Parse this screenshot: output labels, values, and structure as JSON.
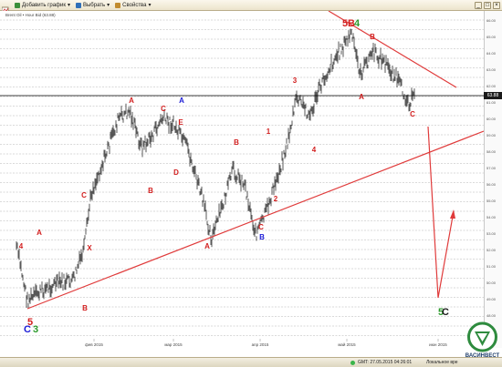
{
  "toolbar": {
    "add_chart": "Добавить график",
    "select": "Выбрать",
    "properties": "Свойства"
  },
  "chart": {
    "legend": "Brent Oil  •  Hour Bid (63.88)",
    "current_price": "63.88",
    "months": [
      "фев 2015",
      "мар 2015",
      "апр 2015",
      "май 2015",
      "июн 2015"
    ],
    "y_ticks": [
      "66.00",
      "65.00",
      "64.00",
      "63.00",
      "62.00",
      "61.00",
      "60.00",
      "59.00",
      "58.00",
      "57.00",
      "56.00",
      "55.00",
      "54.00",
      "53.00",
      "52.00",
      "51.00",
      "50.00",
      "49.00",
      "48.00",
      "47.00"
    ],
    "wave_labels": [
      {
        "t": "A",
        "c": "#d21f1f"
      },
      {
        "t": "A",
        "c": "#1b1bd6"
      },
      {
        "t": "C",
        "c": "#d21f1f"
      },
      {
        "t": "E",
        "c": "#d21f1f"
      },
      {
        "t": "3",
        "c": "#d21f1f"
      },
      {
        "t": "1",
        "c": "#d21f1f"
      },
      {
        "t": "B",
        "c": "#d21f1f"
      },
      {
        "t": "C",
        "c": "#d21f1f"
      },
      {
        "t": "D",
        "c": "#d21f1f"
      },
      {
        "t": "B",
        "c": "#d21f1f"
      },
      {
        "t": "B",
        "c": "#d21f1f"
      },
      {
        "t": "X",
        "c": "#d21f1f"
      },
      {
        "t": "4",
        "c": "#d21f1f"
      },
      {
        "t": "A",
        "c": "#d21f1f"
      },
      {
        "t": "2",
        "c": "#d21f1f"
      },
      {
        "t": "C",
        "c": "#d21f1f"
      },
      {
        "t": "A",
        "c": "#d21f1f"
      },
      {
        "t": "B",
        "c": "#1b1bd6"
      },
      {
        "t": "B",
        "c": "#d21f1f"
      },
      {
        "t": "4",
        "c": "#d21f1f"
      },
      {
        "t": "A",
        "c": "#d21f1f"
      },
      {
        "t": "C",
        "c": "#d21f1f"
      },
      {
        "t": "5",
        "c": "#d21f1f"
      },
      {
        "t": "C",
        "c": "#1b1bd6"
      },
      {
        "t": "3",
        "c": "#2b9a2b"
      },
      {
        "t": "B",
        "c": "#d21f1f"
      },
      {
        "t": "4",
        "c": "#2b9a2b"
      },
      {
        "t": "5",
        "c": "#d21f1f"
      },
      {
        "t": "5",
        "c": "#2b9a2b"
      },
      {
        "t": "C",
        "c": "#1a1a1a"
      }
    ]
  },
  "status": {
    "gmt": "GMT: 27.05.2015 04:26:01",
    "local": "Локальное вре"
  },
  "brand": {
    "name": "ВАСИНВЕСТ"
  }
}
